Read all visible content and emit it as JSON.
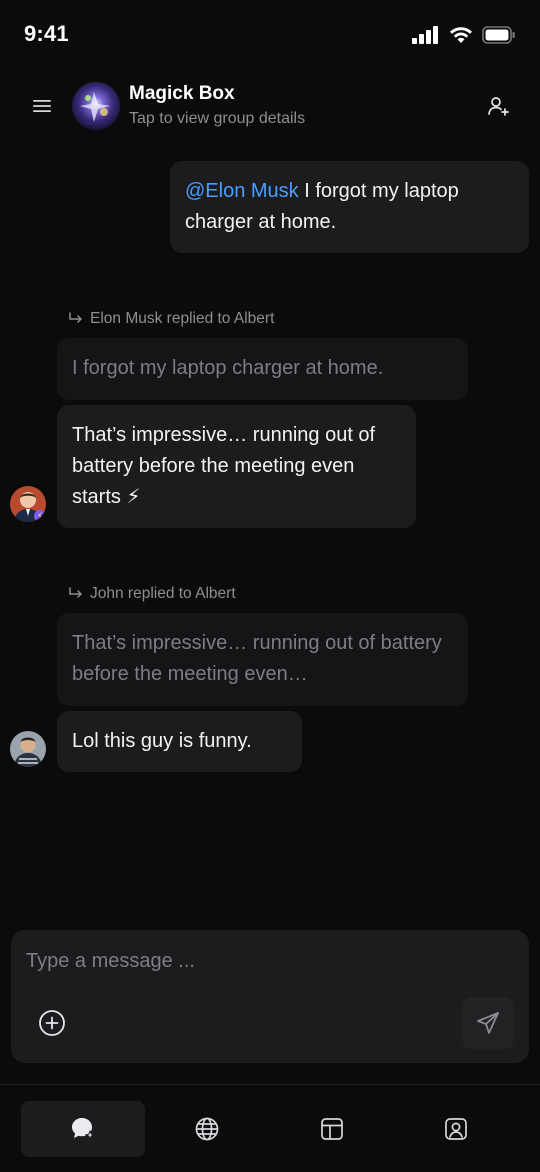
{
  "status_bar": {
    "time": "9:41"
  },
  "header": {
    "group_name": "Magick Box",
    "group_subtitle": "Tap to view group details"
  },
  "messages": [
    {
      "type": "outgoing",
      "mention": "@Elon Musk",
      "text": " I forgot my laptop charger at home."
    },
    {
      "type": "incoming",
      "reply_note": "Elon Musk replied to Albert",
      "quote": "I forgot my laptop charger at home.",
      "text": "That’s impressive… running out of battery before the meeting even starts ⚡"
    },
    {
      "type": "incoming",
      "reply_note": "John replied to Albert",
      "quote": "That’s impressive… running out of battery before the meeting even…",
      "text": "Lol this guy is funny."
    }
  ],
  "composer": {
    "placeholder": "Type a message ..."
  },
  "tabs": [
    {
      "icon": "chat-icon",
      "active": true
    },
    {
      "icon": "globe-icon",
      "active": false
    },
    {
      "icon": "layout-icon",
      "active": false
    },
    {
      "icon": "profile-icon",
      "active": false
    }
  ],
  "colors": {
    "background": "#0b0b0c",
    "bubble": "#1c1c1e",
    "mention": "#4a9eff",
    "muted_text": "#8e8e93"
  }
}
